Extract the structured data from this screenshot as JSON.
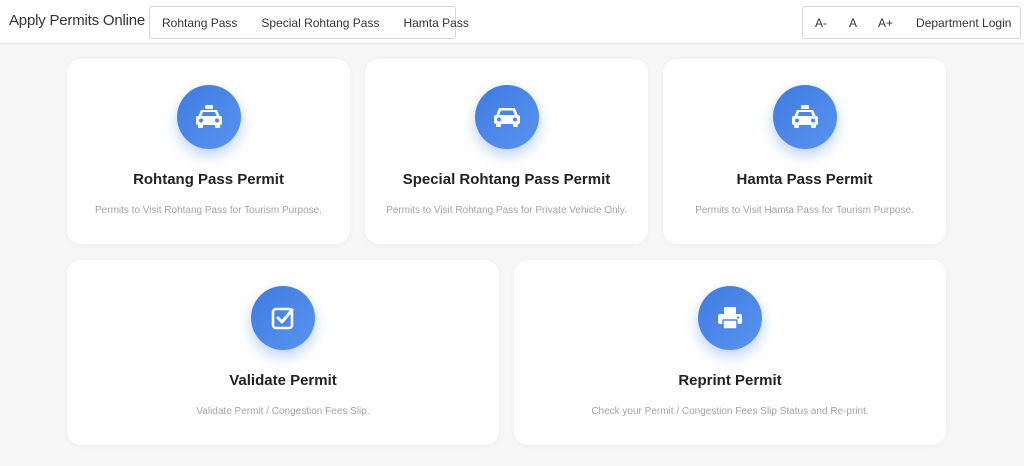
{
  "header": {
    "brand": "Apply Permits Online",
    "nav": [
      {
        "label": "Rohtang Pass"
      },
      {
        "label": "Special Rohtang Pass"
      },
      {
        "label": "Hamta Pass"
      }
    ],
    "tools": {
      "decrease_font": "A-",
      "normal_font": "A",
      "increase_font": "A+",
      "department_login": "Department Login"
    }
  },
  "cards": [
    {
      "icon": "taxi-icon",
      "title": "Rohtang Pass Permit",
      "description": "Permits to Visit Rohtang Pass for Tourism Purpose."
    },
    {
      "icon": "car-icon",
      "title": "Special Rohtang Pass Permit",
      "description": "Permits to Visit Rohtang Pass for Private Vehicle Only."
    },
    {
      "icon": "taxi-icon",
      "title": "Hamta Pass Permit",
      "description": "Permits to Visit Hamta Pass for Tourism Purpose."
    },
    {
      "icon": "check-square-icon",
      "title": "Validate Permit",
      "description": "Validate Permit / Congestion Fees Slip."
    },
    {
      "icon": "print-icon",
      "title": "Reprint Permit",
      "description": "Check your Permit / Congestion Fees Slip Status and Re-print."
    }
  ],
  "colors": {
    "accent": "#4a86e8",
    "background": "#f6f6f7",
    "card": "#ffffff",
    "description": "#a4a4a4"
  }
}
